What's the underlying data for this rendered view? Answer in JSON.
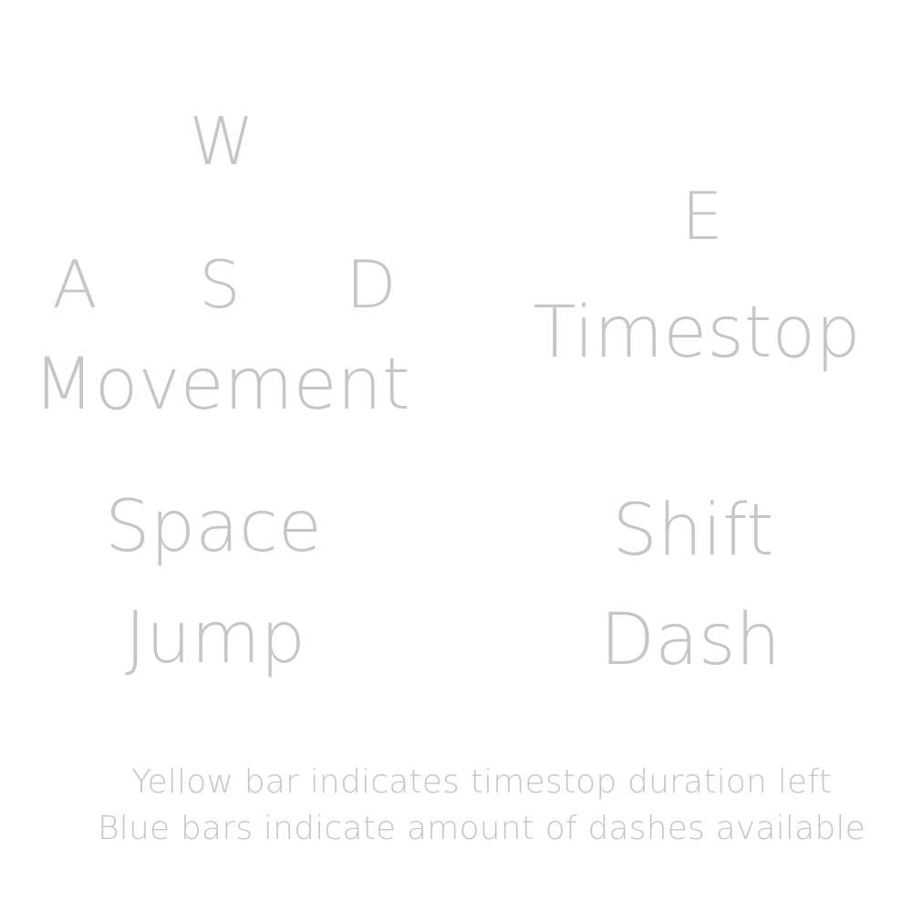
{
  "controls": {
    "movement": {
      "keys": [
        "W",
        "A",
        "S",
        "D"
      ],
      "label": "Movement"
    },
    "timestop": {
      "key": "E",
      "label": "Timestop"
    },
    "jump": {
      "key": "Space",
      "label": "Jump"
    },
    "dash": {
      "key": "Shift",
      "label": "Dash"
    }
  },
  "hints": [
    "Yellow bar indicates timestop duration left",
    "Blue bars indicate amount of dashes available"
  ],
  "colors": {
    "background": "#ffffff",
    "text": "#c6c6c6"
  }
}
